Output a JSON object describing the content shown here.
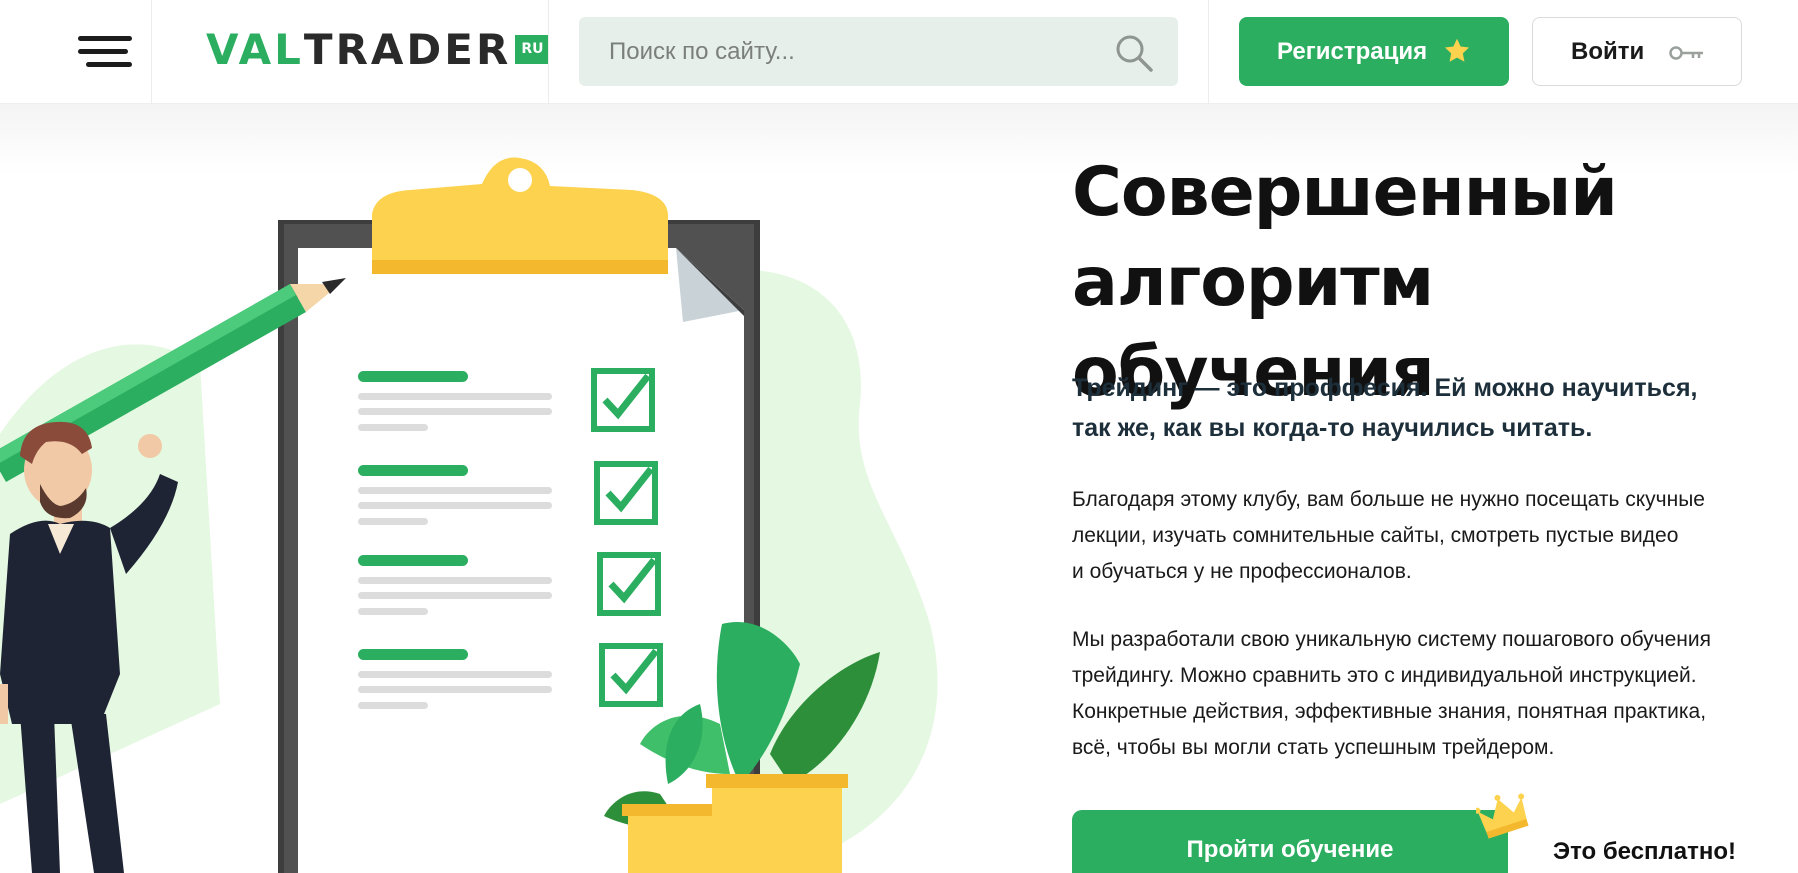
{
  "header": {
    "logo": {
      "part1": "VAL",
      "part2": "TRADER",
      "badge": "RU"
    },
    "search": {
      "placeholder": "Поиск по сайту..."
    },
    "register_label": "Регистрация",
    "login_label": "Войти"
  },
  "hero": {
    "title_line1": "Совершенный",
    "title_line2": "алгоритм обучения",
    "lead_line1": "Трейдинг — это проффесия. Ей можно научиться,",
    "lead_line2": "так же, как вы когда-то научились читать.",
    "paragraph1": [
      "Благодаря этому клубу, вам больше не нужно посещать скучные",
      "лекции, изучать сомнительные сайты, смотреть пустые видео",
      "и обучаться у не профессионалов."
    ],
    "paragraph2": [
      "Мы разработали свою уникальную систему пошагового обучения",
      "трейдингу. Можно сравнить это с индивидуальной инструкцией.",
      "Конкретные действия, эффективные знания, понятная практика,",
      "всё, чтобы вы могли стать успешным трейдером."
    ],
    "cta_label": "Пройти обучение",
    "free_label": "Это бесплатно!"
  },
  "icons": [
    "menu-icon",
    "search-icon",
    "star-icon",
    "key-icon",
    "crown-icon"
  ],
  "colors": {
    "brand_green": "#2bae60",
    "search_bg": "#e6efea",
    "dark_text": "#111111",
    "clip_yellow": "#fdd24e"
  }
}
